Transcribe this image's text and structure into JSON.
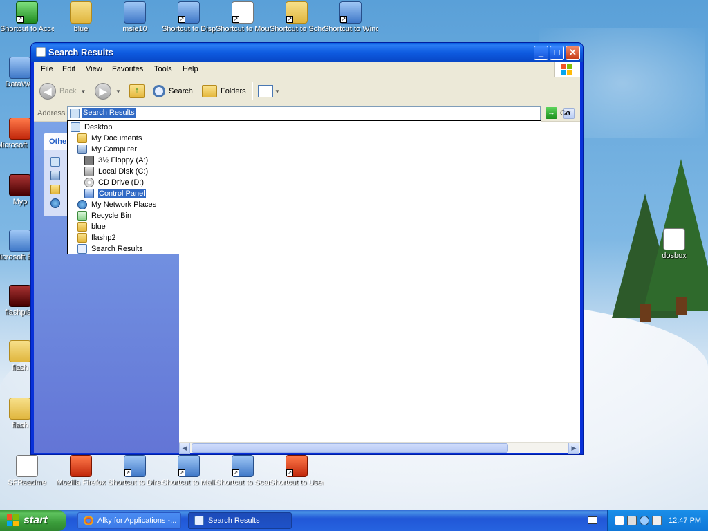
{
  "desktop": {
    "icons": [
      {
        "label": "Shortcut to Accessibil",
        "style": "green"
      },
      {
        "label": "blue",
        "style": "folder"
      },
      {
        "label": "msie10",
        "style": "app"
      },
      {
        "label": "Shortcut to Display",
        "style": "app"
      },
      {
        "label": "Shortcut to Mouse",
        "style": "doc"
      },
      {
        "label": "Shortcut to Schedul",
        "style": "folder"
      },
      {
        "label": "Shortcut to Window",
        "style": "app"
      },
      {
        "label": "DataWar",
        "style": "app"
      },
      {
        "label": "Microsoft C++",
        "style": "red"
      },
      {
        "label": "Myp",
        "style": "dark"
      },
      {
        "label": "Microsoft Basic",
        "style": "app"
      },
      {
        "label": "flashplay",
        "style": "dark"
      },
      {
        "label": "flash",
        "style": "folder"
      },
      {
        "label": "flash",
        "style": "folder"
      },
      {
        "label": "dosbox",
        "style": "doc"
      },
      {
        "label": "SFReadme",
        "style": "doc"
      },
      {
        "label": "Mozilla Firefox",
        "style": "red"
      },
      {
        "label": "Shortcut to DirectX ...",
        "style": "app"
      },
      {
        "label": "Shortcut to Malicious R...",
        "style": "app"
      },
      {
        "label": "Shortcut to Scanners a...",
        "style": "app"
      },
      {
        "label": "Shortcut to User Accounts",
        "style": "red"
      }
    ]
  },
  "window": {
    "title": "Search Results",
    "menu": [
      "File",
      "Edit",
      "View",
      "Favorites",
      "Tools",
      "Help"
    ],
    "toolbar": {
      "back": "Back",
      "search": "Search",
      "folders": "Folders"
    },
    "address": {
      "label": "Address",
      "value": "Search Results",
      "go": "Go"
    },
    "taskpane": {
      "title": "Othe"
    },
    "dropdown_items": [
      {
        "label": "Desktop",
        "icon": "desktop",
        "indent": 0
      },
      {
        "label": "My Documents",
        "icon": "folder",
        "indent": 1
      },
      {
        "label": "My Computer",
        "icon": "computer",
        "indent": 1
      },
      {
        "label": "3½ Floppy (A:)",
        "icon": "floppy",
        "indent": 2
      },
      {
        "label": "Local Disk (C:)",
        "icon": "disk",
        "indent": 2
      },
      {
        "label": "CD Drive (D:)",
        "icon": "cd",
        "indent": 2
      },
      {
        "label": "Control Panel",
        "icon": "cpanel",
        "indent": 2,
        "selected": true
      },
      {
        "label": "My Network Places",
        "icon": "network",
        "indent": 1
      },
      {
        "label": "Recycle Bin",
        "icon": "recycle",
        "indent": 1
      },
      {
        "label": "blue",
        "icon": "folder",
        "indent": 1
      },
      {
        "label": "flashp2",
        "icon": "folder",
        "indent": 1
      },
      {
        "label": "Search Results",
        "icon": "search",
        "indent": 1
      }
    ]
  },
  "taskbar": {
    "start": "start",
    "tasks": [
      {
        "label": "Alky for Applications -...",
        "active": false
      },
      {
        "label": "Search Results",
        "active": true
      }
    ],
    "clock": "12:47 PM"
  },
  "colors": {
    "title_blue": "#0a5fe0",
    "selection": "#316ac5",
    "start_green": "#3c9a3c",
    "taskbar_blue": "#2157d7"
  }
}
